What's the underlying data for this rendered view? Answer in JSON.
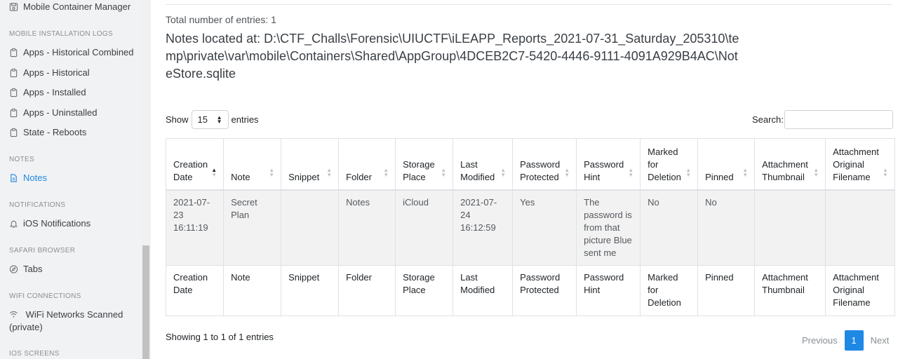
{
  "sidebar": {
    "top_item": "Mobile Container Manager",
    "sections": [
      {
        "heading": "MOBILE INSTALLATION LOGS"
      },
      {
        "heading": "NOTES"
      },
      {
        "heading": "NOTIFICATIONS"
      },
      {
        "heading": "SAFARI BROWSER"
      },
      {
        "heading": "WIFI CONNECTIONS"
      },
      {
        "heading": "IOS SCREENS"
      }
    ],
    "items": {
      "apps_hist_combined": "Apps - Historical Combined",
      "apps_hist": "Apps - Historical",
      "apps_installed": "Apps - Installed",
      "apps_uninstalled": "Apps - Uninstalled",
      "state_reboots": "State - Reboots",
      "notes": "Notes",
      "ios_notifications": "iOS Notifications",
      "tabs": "Tabs",
      "wifi_scanned": "WiFi Networks Scanned (private)"
    },
    "active_color": "#1e88e5"
  },
  "main": {
    "total": "Total number of entries: 1",
    "location": "Notes located at: D:\\CTF_Challs\\Forensic\\UIUCTF\\iLEAPP_Reports_2021-07-31_Saturday_205310\\temp\\private\\var\\mobile\\Containers\\Shared\\AppGroup\\4DCEB2C7-5420-4446-9111-4091A929B4AC\\NoteStore.sqlite",
    "show_label": "Show",
    "page_size": "15",
    "entries_label": "entries",
    "search_label": "Search:"
  },
  "table": {
    "columns": [
      "Creation Date",
      "Note",
      "Snippet",
      "Folder",
      "Storage Place",
      "Last Modified",
      "Password Protected",
      "Password Hint",
      "Marked for Deletion",
      "Pinned",
      "Attachment Thumbnail",
      "Attachment Original Filename"
    ],
    "rows": [
      [
        "2021-07-23 16:11:19",
        "Secret Plan",
        "",
        "Notes",
        "iCloud",
        "2021-07-24 16:12:59",
        "Yes",
        "The password is from that picture Blue sent me",
        "No",
        "No",
        "",
        ""
      ]
    ]
  },
  "footer": {
    "showing": "Showing 1 to 1 of 1 entries",
    "previous": "Previous",
    "page": "1",
    "next": "Next"
  }
}
